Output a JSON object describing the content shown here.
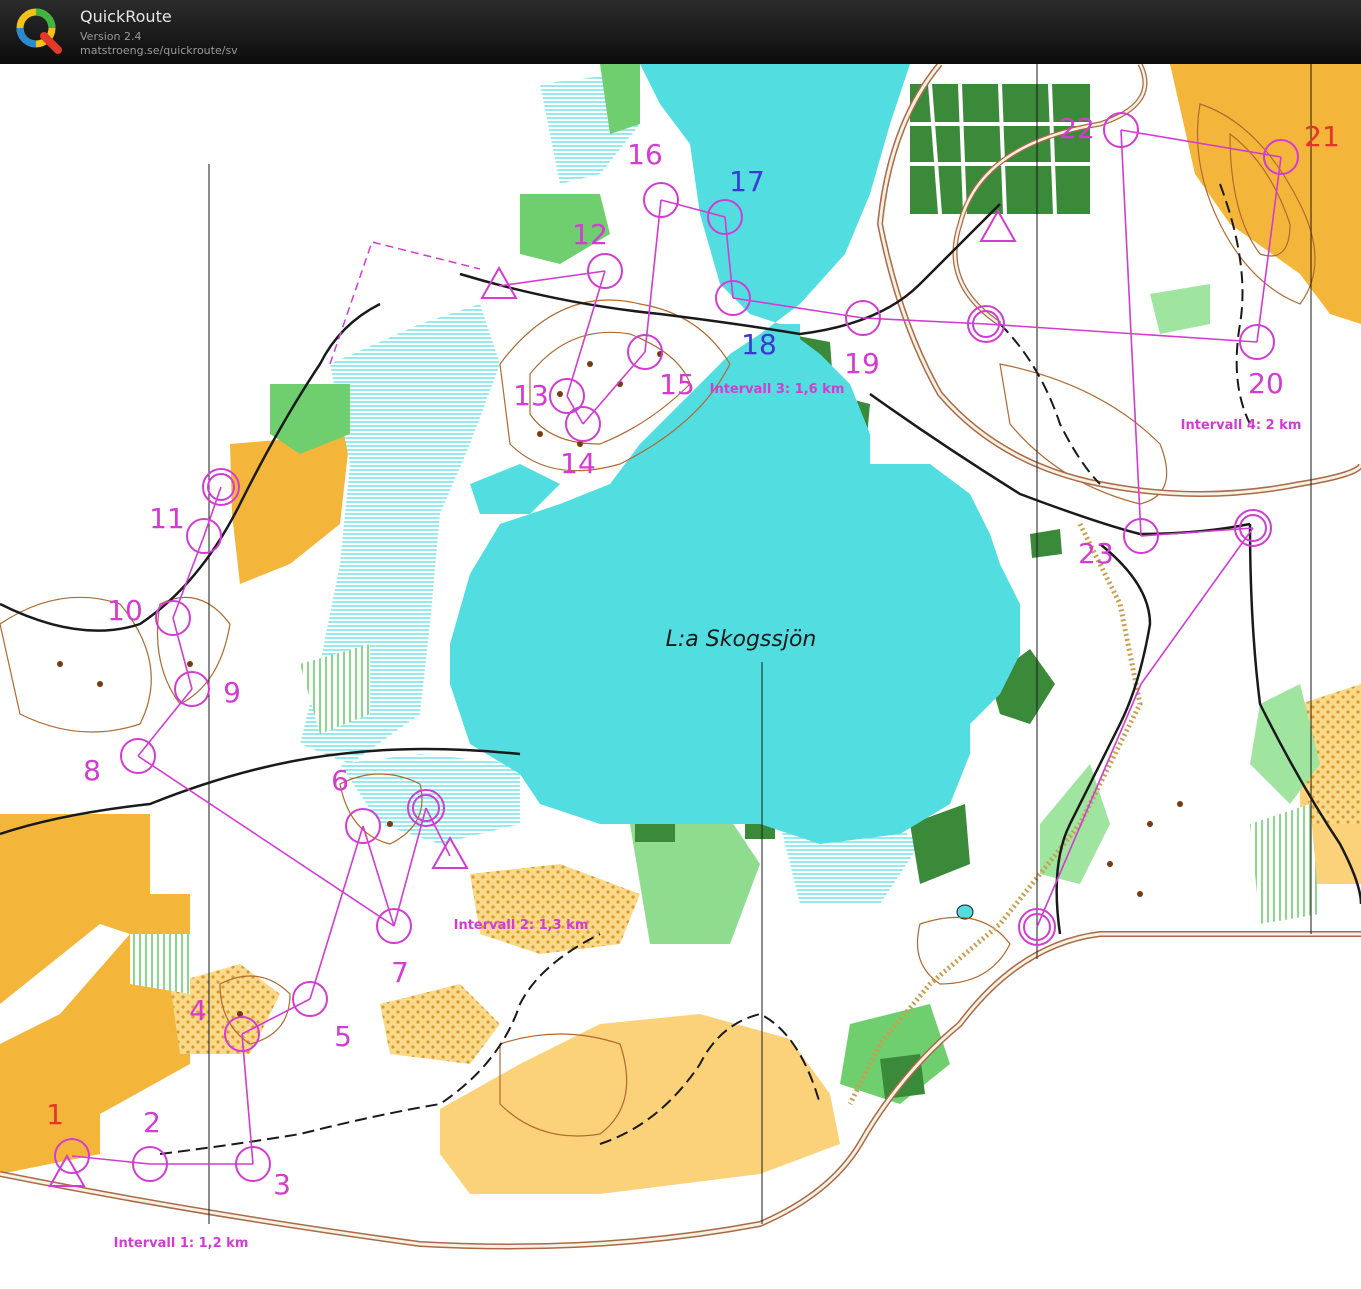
{
  "app": {
    "title": "QuickRoute",
    "version": "Version 2.4",
    "url": "matstroeng.se/quickroute/sv",
    "logo_letter": "Q"
  },
  "map": {
    "lake_name": "L:a Skogssjön",
    "intervals": [
      {
        "label": "Intervall 1: 1,2 km"
      },
      {
        "label": "Intervall 2: 1,3 km"
      },
      {
        "label": "Intervall 3: 1,6 km"
      },
      {
        "label": "Intervall 4: 2 km"
      }
    ],
    "controls": [
      {
        "label": "1",
        "color": "#e8322e"
      },
      {
        "label": "2",
        "color": "#d23cd2"
      },
      {
        "label": "3",
        "color": "#d23cd2"
      },
      {
        "label": "4",
        "color": "#d23cd2"
      },
      {
        "label": "5",
        "color": "#d23cd2"
      },
      {
        "label": "6",
        "color": "#d23cd2"
      },
      {
        "label": "7",
        "color": "#d23cd2"
      },
      {
        "label": "8",
        "color": "#d23cd2"
      },
      {
        "label": "9",
        "color": "#d23cd2"
      },
      {
        "label": "10",
        "color": "#d23cd2"
      },
      {
        "label": "11",
        "color": "#d23cd2"
      },
      {
        "label": "12",
        "color": "#d23cd2"
      },
      {
        "label": "13",
        "color": "#d23cd2"
      },
      {
        "label": "14",
        "color": "#d23cd2"
      },
      {
        "label": "15",
        "color": "#d23cd2"
      },
      {
        "label": "16",
        "color": "#d23cd2"
      },
      {
        "label": "17",
        "color": "#3a3ad2"
      },
      {
        "label": "18",
        "color": "#3a3ad2"
      },
      {
        "label": "19",
        "color": "#d23cd2"
      },
      {
        "label": "20",
        "color": "#d23cd2"
      },
      {
        "label": "21",
        "color": "#e8322e"
      },
      {
        "label": "22",
        "color": "#d23cd2"
      },
      {
        "label": "23",
        "color": "#d23cd2"
      }
    ],
    "colors": {
      "water": "#52dde0",
      "open_land": "#f4b63a",
      "rough_open": "#fad27a",
      "green": "#6fcf6f",
      "dark_green": "#3a8a3a",
      "contour": "#b06a30",
      "course": "#d23cd2",
      "road": "#a86a48"
    }
  }
}
